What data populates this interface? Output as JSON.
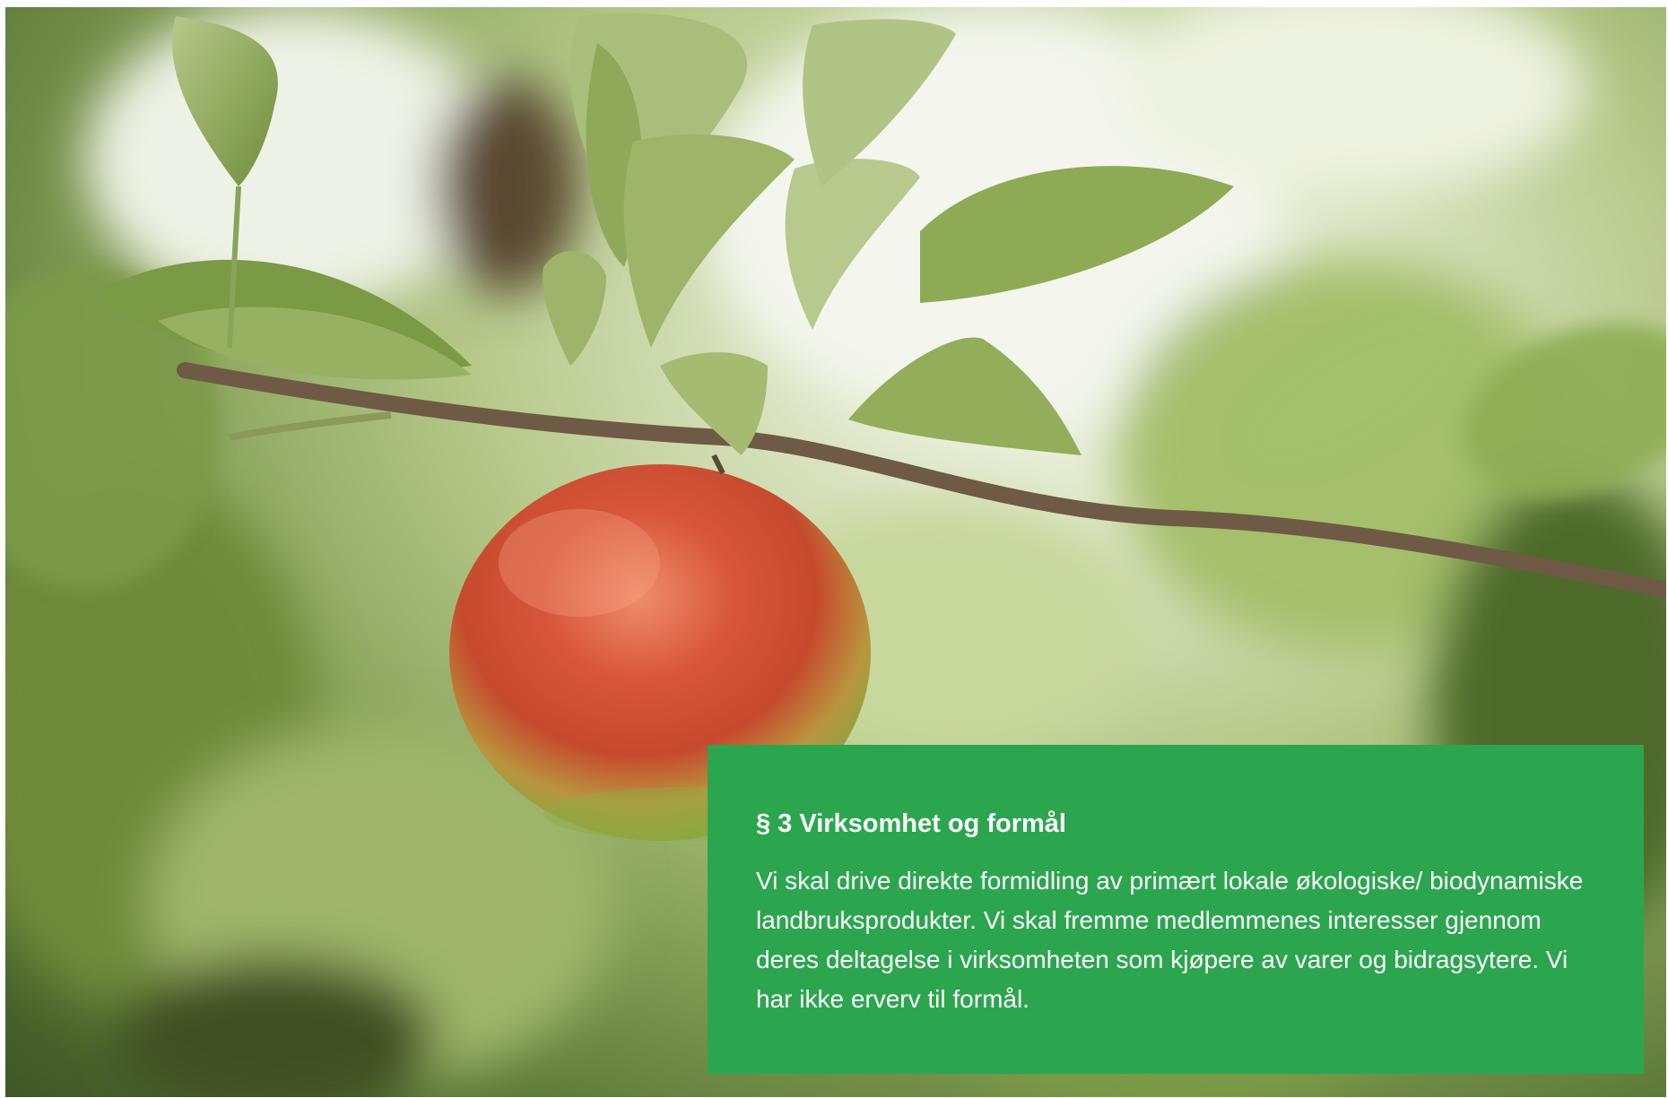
{
  "hero": {
    "image_icon": "apple-on-branch-photo"
  },
  "info_card": {
    "title": "§ 3 Virksomhet og formål",
    "body": "Vi skal drive direkte formidling av primært lokale økologiske/ biodynamiske landbruksprodukter. Vi skal fremme medlemmenes interesser gjennom deres deltagelse i virksomheten som kjøpere av varer og bidragsytere. Vi har ikke erverv til formål.",
    "background_color": "#2ba64f",
    "text_color": "#ffffff"
  }
}
